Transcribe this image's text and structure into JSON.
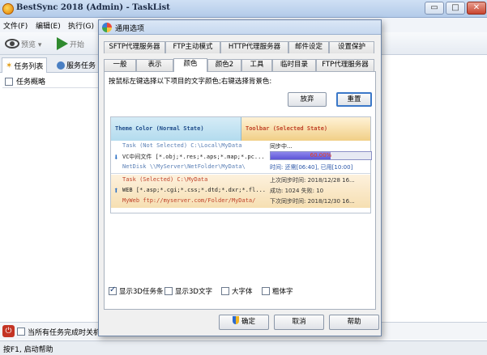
{
  "window": {
    "title": "BestSync 2018 (Admin) - TaskList",
    "buttons": [
      "▭",
      "□",
      "✕"
    ]
  },
  "menu": {
    "items": [
      "文件(F)",
      "编辑(E)",
      "执行(G)"
    ]
  },
  "toolbar": {
    "preview_label": "预览 ▾",
    "start_label": "开始"
  },
  "main_tabs": [
    "任务列表",
    "服务任务"
  ],
  "list": {
    "header": "任务概略"
  },
  "bottom": {
    "shutdown_label": "当所有任务完成时关机 •"
  },
  "status": {
    "text": "按F1, 启动帮助"
  },
  "dialog": {
    "title": "通用选项",
    "tabs_row1": [
      "SFTP代理服务器",
      "FTP主动模式",
      "HTTP代理服务器",
      "邮件设定",
      "设置保护"
    ],
    "tabs_row2": [
      "一般",
      "表示",
      "颜色",
      "颜色2",
      "工具",
      "临时目录",
      "FTP代理服务器"
    ],
    "active_tab": "颜色",
    "instruction": "按鼠标左键选择以下项目的文字颜色;右键选择背景色:",
    "discard_label": "放弃",
    "reset_label": "重置",
    "preview": {
      "normal_header": "Theme Color (Normal State)",
      "selected_header": "Toolbar (Selected State)",
      "normal_task": {
        "line1_left": "Task (Not Selected) C:\\Local\\MyData",
        "line1_right": "同步中...",
        "line2_left": "VC中间文件 [*.obj;*.res;*.aps;*.map;*.pc...",
        "progress_percent": 60,
        "progress_label": "60.00%",
        "line3_left": "NetDisk \\\\MyServer\\NetFolder\\MyData\\",
        "line3_right": "时间: 还需[06:40], 已用[10:00]"
      },
      "selected_task": {
        "line1_left": "Task (Selected)  C:\\MyData",
        "line1_right": "上次同步时间:  2018/12/28 16...",
        "line2_left": "WEB [*.asp;*.cgi;*.css;*.dtd;*.dxr;*.fl...",
        "line2_right": "成功: 1024  失败: 10",
        "line3_left": "MyWeb ftp://myserver.com/Folder/MyData/",
        "line3_right": "下次同步时间:  2018/12/30 16..."
      }
    },
    "options": [
      {
        "label": "显示3D任务条",
        "checked": true
      },
      {
        "label": "显示3D文字",
        "checked": false
      },
      {
        "label": "大字体",
        "checked": false
      },
      {
        "label": "粗体字",
        "checked": false
      }
    ],
    "ok_label": "确定",
    "cancel_label": "取消",
    "help_label": "帮助"
  }
}
